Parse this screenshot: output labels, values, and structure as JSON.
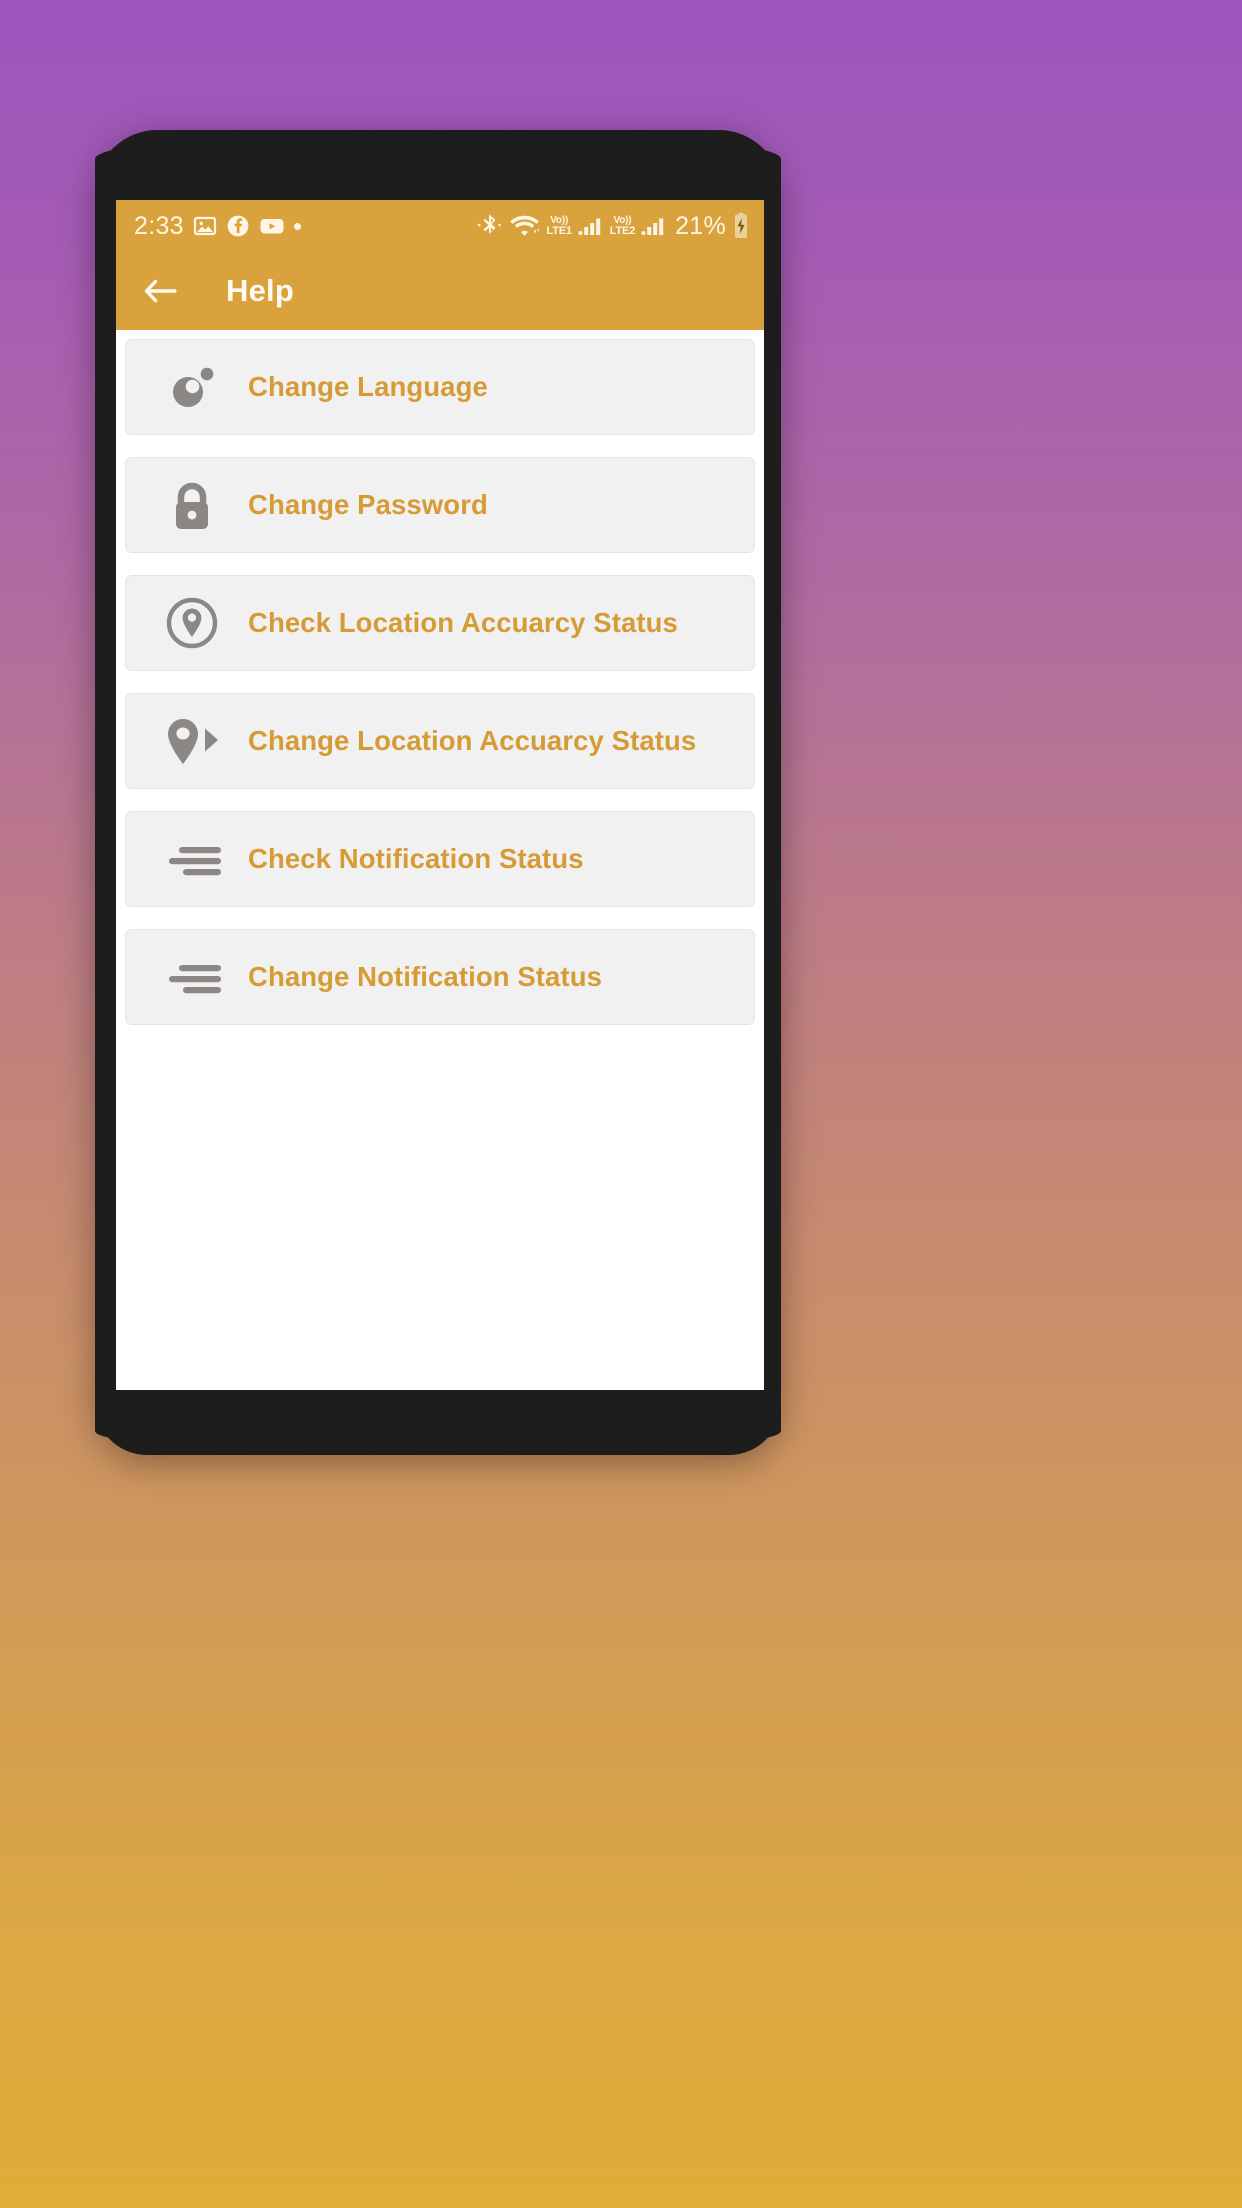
{
  "device": {
    "frame_color": "#1d1d1d",
    "background_gradient_top": "#9b55bd",
    "background_gradient_bottom": "#e0ad38"
  },
  "statusbar": {
    "background": "#d9a23c",
    "time": "2:33",
    "left_icons": [
      "photos-icon",
      "facebook-icon",
      "youtube-icon",
      "more-dot-icon"
    ],
    "right_icons": [
      "bluetooth-icon",
      "wifi-icon",
      "signal-bars-icon",
      "signal-bars-icon",
      "battery-icon"
    ],
    "sim1_network_vo": "Vo))",
    "sim1_network": "LTE1",
    "sim2_network_vo": "Vo))",
    "sim2_network": "LTE2",
    "battery_percent": "21%"
  },
  "appbar": {
    "background": "#d9a23c",
    "back_icon": "arrow-left-icon",
    "title": "Help"
  },
  "content": {
    "background": "#ffffff",
    "item_background": "#f1f1f1",
    "label_color": "#d79b35",
    "icon_color": "#8c8785",
    "items": [
      {
        "label": "Change Language",
        "icon": "language-bubble-icon"
      },
      {
        "label": "Change Password",
        "icon": "lock-icon"
      },
      {
        "label": "Check Location Accuarcy Status",
        "icon": "location-circle-icon"
      },
      {
        "label": "Change Location Accuarcy Status",
        "icon": "location-pin-arrow-icon"
      },
      {
        "label": "Check Notification Status",
        "icon": "notification-lines-icon"
      },
      {
        "label": "Change Notification Status",
        "icon": "notification-lines-icon"
      }
    ]
  }
}
